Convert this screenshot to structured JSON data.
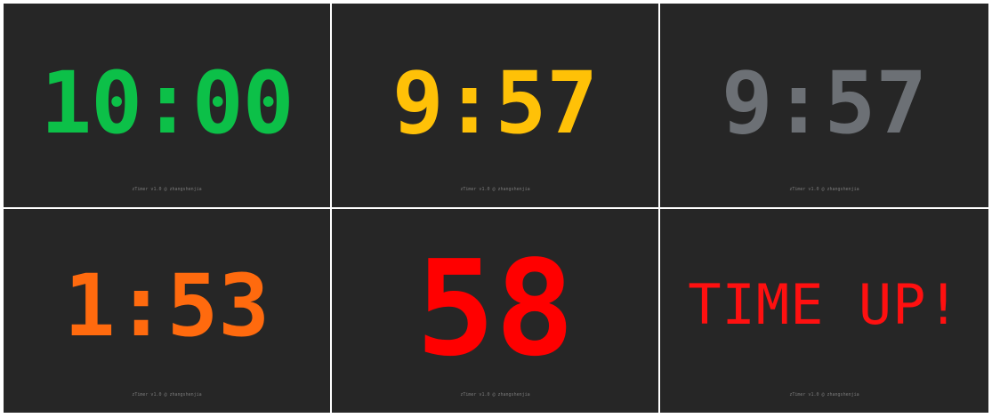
{
  "footer_text": "zTimer v1.0 @ zhangshenjia",
  "panels": [
    {
      "time": "10:00",
      "color": "#0cc048"
    },
    {
      "time": "9:57",
      "color": "#ffc107"
    },
    {
      "time": "9:57",
      "color": "#6c7075"
    },
    {
      "time": "1:53",
      "color": "#ff6a0e"
    },
    {
      "time": "58",
      "color": "#ff0000"
    },
    {
      "time": "TIME UP!",
      "color": "#ff1010"
    }
  ]
}
